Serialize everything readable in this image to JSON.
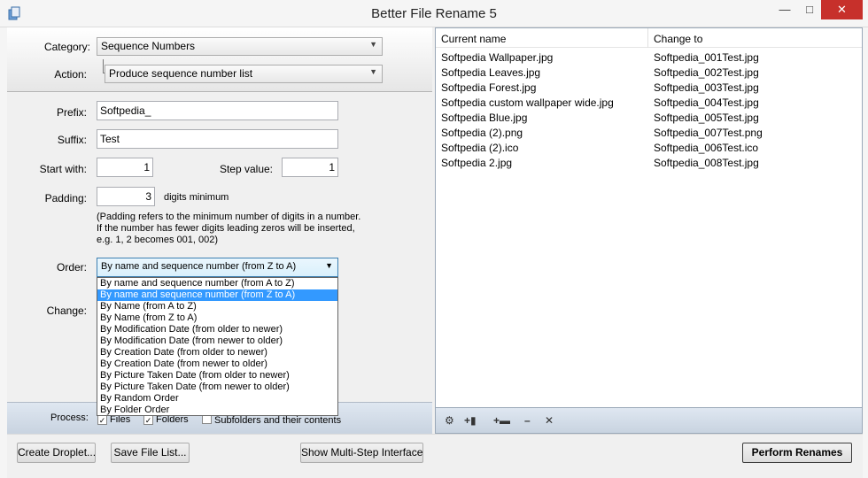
{
  "window": {
    "title": "Better File Rename 5"
  },
  "controls": {
    "minimize": "—",
    "maximize": "□",
    "close": "✕"
  },
  "category": {
    "label": "Category:",
    "value": "Sequence Numbers"
  },
  "action": {
    "label": "Action:",
    "value": "Produce sequence number list"
  },
  "prefix": {
    "label": "Prefix:",
    "value": "Softpedia_"
  },
  "suffix": {
    "label": "Suffix:",
    "value": "Test"
  },
  "start": {
    "label": "Start with:",
    "value": "1"
  },
  "step": {
    "label": "Step value:",
    "value": "1"
  },
  "padding": {
    "label": "Padding:",
    "value": "3",
    "unit": "digits minimum",
    "note": "(Padding refers to the minimum number of digits in a number. If the number has fewer digits leading zeros will be inserted, e.g. 1, 2 becomes 001, 002)"
  },
  "order": {
    "label": "Order:",
    "value": "By name and sequence number (from Z to A)",
    "options": [
      "By name and sequence number (from A to Z)",
      "By name and sequence number (from Z to A)",
      "By Name (from A to Z)",
      "By Name (from Z to A)",
      "By Modification Date (from older to newer)",
      "By Modification Date (from newer to older)",
      "By Creation Date (from older to newer)",
      "By Creation Date (from newer to older)",
      "By Picture Taken Date (from older to newer)",
      "By Picture Taken Date (from newer to older)",
      "By Random Order",
      "By Folder Order"
    ],
    "selected_index": 1
  },
  "change": {
    "label": "Change:"
  },
  "process": {
    "label": "Process:",
    "files": "Files",
    "folders": "Folders",
    "subfolders": "Subfolders and their contents"
  },
  "file_list": {
    "headers": [
      "Current name",
      "Change to"
    ],
    "rows": [
      [
        "Softpedia Wallpaper.jpg",
        "Softpedia_001Test.jpg"
      ],
      [
        "Softpedia Leaves.jpg",
        "Softpedia_002Test.jpg"
      ],
      [
        "Softpedia Forest.jpg",
        "Softpedia_003Test.jpg"
      ],
      [
        "Softpedia custom wallpaper wide.jpg",
        "Softpedia_004Test.jpg"
      ],
      [
        "Softpedia Blue.jpg",
        "Softpedia_005Test.jpg"
      ],
      [
        "Softpedia (2).png",
        "Softpedia_007Test.png"
      ],
      [
        "Softpedia (2).ico",
        "Softpedia_006Test.ico"
      ],
      [
        "Softpedia 2.jpg",
        "Softpedia_008Test.jpg"
      ]
    ]
  },
  "toolbar_icons": [
    "gear-icon",
    "add-file-icon",
    "add-folder-icon",
    "remove-icon",
    "clear-icon"
  ],
  "buttons": {
    "create_droplet": "Create Droplet...",
    "save_file_list": "Save File List...",
    "multi_step": "Show Multi-Step Interface",
    "perform": "Perform Renames"
  }
}
